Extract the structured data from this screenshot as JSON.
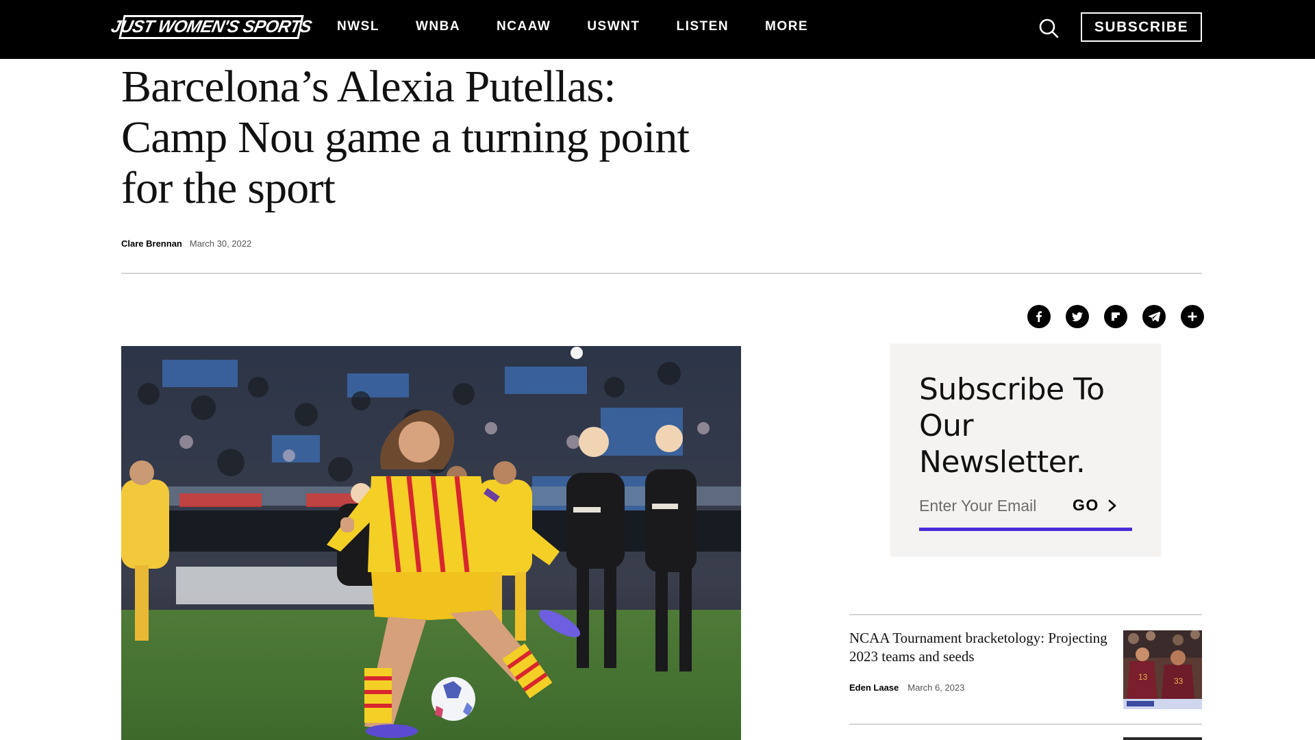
{
  "header": {
    "logo_text": "JUST WOMEN'S SPORTS",
    "nav": [
      "NWSL",
      "WNBA",
      "NCAAW",
      "USWNT",
      "LISTEN",
      "MORE"
    ],
    "subscribe_label": "SUBSCRIBE"
  },
  "article": {
    "title": "Barcelona’s Alexia Putellas: Camp Nou game a turning point for the sport",
    "author": "Clare Brennan",
    "date": "March 30, 2022"
  },
  "share": {
    "icons": [
      "facebook-icon",
      "twitter-icon",
      "flipboard-icon",
      "telegram-icon",
      "plus-icon"
    ]
  },
  "newsletter": {
    "title": "Subscribe To Our Newsletter.",
    "email_placeholder": "Enter Your Email",
    "go_label": "GO",
    "accent": "#4b2bd9"
  },
  "sidebar": {
    "articles": [
      {
        "title": "NCAA Tournament bracketology: Projecting 2023 teams and seeds",
        "author": "Eden Laase",
        "date": "March 6, 2023"
      }
    ]
  },
  "colors": {
    "header_bg": "#000000",
    "barcelona_yellow": "#f4cf25",
    "barcelona_red": "#d8262e"
  }
}
